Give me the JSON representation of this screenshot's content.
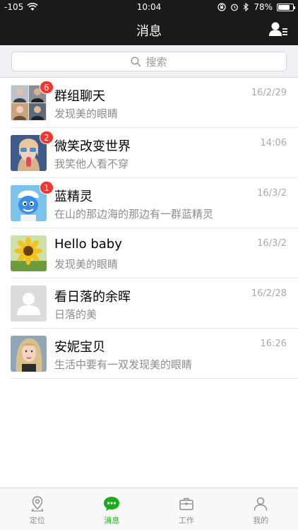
{
  "status_bar": {
    "signal": "-105",
    "time": "10:04",
    "battery": "78%",
    "battery_level": 0.78,
    "icons": [
      "wifi-icon",
      "orientation-lock-icon",
      "alarm-icon",
      "bluetooth-icon"
    ]
  },
  "nav": {
    "title": "消息",
    "right_icon": "contacts-icon"
  },
  "search": {
    "placeholder": "搜索"
  },
  "chats": [
    {
      "name": "群组聊天",
      "message": "发现美的眼睛",
      "time": "16/2/29",
      "badge": "6",
      "avatar": "group-avatar"
    },
    {
      "name": "微笑改变世界",
      "message": "我笑他人看不穿",
      "time": "14:06",
      "badge": "2",
      "avatar": "girl-popsicle-avatar"
    },
    {
      "name": "蓝精灵",
      "message": "在山的那边海的那边有一群蓝精灵",
      "time": "16/3/2",
      "badge": "1",
      "avatar": "smurf-avatar"
    },
    {
      "name": "Hello baby",
      "message": "发现美的眼睛",
      "time": "16/3/2",
      "badge": "",
      "avatar": "sunflower-avatar"
    },
    {
      "name": "看日落的余晖",
      "message": "日落的美",
      "time": "16/2/28",
      "badge": "",
      "avatar": "default-avatar"
    },
    {
      "name": "安妮宝贝",
      "message": "生活中要有一双发现美的眼睛",
      "time": "16:26",
      "badge": "",
      "avatar": "blonde-avatar"
    }
  ],
  "tabs": [
    {
      "label": "定位",
      "icon": "location-icon",
      "active": false
    },
    {
      "label": "消息",
      "icon": "chat-bubble-icon",
      "active": true
    },
    {
      "label": "工作",
      "icon": "briefcase-icon",
      "active": false
    },
    {
      "label": "我的",
      "icon": "person-icon",
      "active": false
    }
  ],
  "colors": {
    "nav_bg": "#1a1a1a",
    "accent": "#1aad19",
    "badge": "#f43530",
    "list_bg": "#ffffff",
    "search_bg": "#efeff4"
  }
}
